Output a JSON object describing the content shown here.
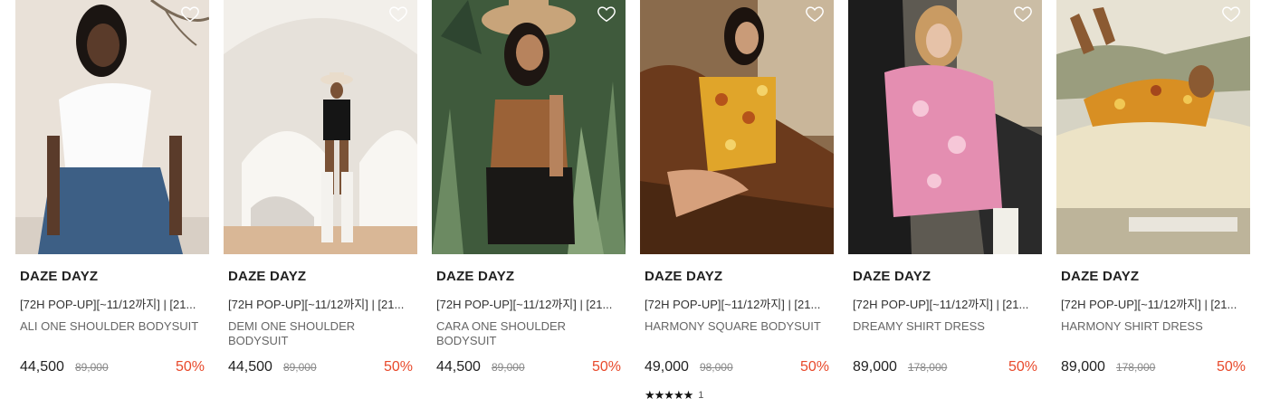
{
  "products": [
    {
      "brand": "DAZE DAYZ",
      "promo": "[72H POP-UP][~11/12까지] | [21...",
      "name": "ALI ONE SHOULDER BODYSUIT",
      "price": "44,500",
      "original_price": "89,000",
      "discount": "50%",
      "rating": null
    },
    {
      "brand": "DAZE DAYZ",
      "promo": "[72H POP-UP][~11/12까지] | [21...",
      "name": "DEMI ONE SHOULDER BODYSUIT",
      "price": "44,500",
      "original_price": "89,000",
      "discount": "50%",
      "rating": null
    },
    {
      "brand": "DAZE DAYZ",
      "promo": "[72H POP-UP][~11/12까지] | [21...",
      "name": "CARA ONE SHOULDER BODYSUIT",
      "price": "44,500",
      "original_price": "89,000",
      "discount": "50%",
      "rating": null
    },
    {
      "brand": "DAZE DAYZ",
      "promo": "[72H POP-UP][~11/12까지] | [21...",
      "name": "HARMONY SQUARE BODYSUIT",
      "price": "49,000",
      "original_price": "98,000",
      "discount": "50%",
      "rating": {
        "stars": "★★★★★",
        "count": "1"
      }
    },
    {
      "brand": "DAZE DAYZ",
      "promo": "[72H POP-UP][~11/12까지] | [21...",
      "name": "DREAMY SHIRT DRESS",
      "price": "89,000",
      "original_price": "178,000",
      "discount": "50%",
      "rating": null
    },
    {
      "brand": "DAZE DAYZ",
      "promo": "[72H POP-UP][~11/12까지] | [21...",
      "name": "HARMONY SHIRT DRESS",
      "price": "89,000",
      "original_price": "178,000",
      "discount": "50%",
      "rating": null
    }
  ],
  "colors": {
    "discount": "#e8492b",
    "price": "#222222",
    "name": "#666666"
  },
  "icons": {
    "wishlist": "heart-outline-icon",
    "rating": "star-icon"
  }
}
